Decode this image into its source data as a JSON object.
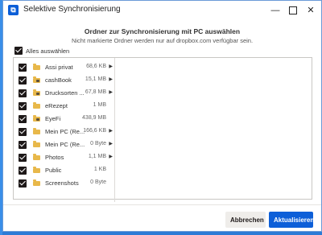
{
  "window": {
    "title": "Selektive Synchronisierung",
    "app_icon": "dropbox-app-icon"
  },
  "dialog": {
    "heading": "Ordner zur Synchronisierung mit PC auswählen",
    "subheading": "Nicht markierte Ordner werden nur auf dropbox.com verfügbar sein."
  },
  "select_all": {
    "label": "Alles auswählen",
    "checked": true
  },
  "folders": [
    {
      "name": "Assi privat",
      "size": "68,6 KB",
      "has_children": true,
      "shared": false,
      "checked": true
    },
    {
      "name": "cashBook",
      "size": "15,1 MB",
      "has_children": true,
      "shared": true,
      "checked": true
    },
    {
      "name": "Drucksorten ...",
      "size": "67,8 MB",
      "has_children": true,
      "shared": true,
      "checked": true
    },
    {
      "name": "eRezept",
      "size": "1 MB",
      "has_children": false,
      "shared": false,
      "checked": true
    },
    {
      "name": "EyeFi",
      "size": "438,9 MB",
      "has_children": false,
      "shared": true,
      "checked": true
    },
    {
      "name": "Mein PC (Re...",
      "size": "166,6 KB",
      "has_children": true,
      "shared": false,
      "checked": true
    },
    {
      "name": "Mein PC (Re...",
      "size": "0 Byte",
      "has_children": true,
      "shared": false,
      "checked": true
    },
    {
      "name": "Photos",
      "size": "1,1 MB",
      "has_children": true,
      "shared": false,
      "checked": true
    },
    {
      "name": "Public",
      "size": "1 KB",
      "has_children": false,
      "shared": false,
      "checked": true
    },
    {
      "name": "Screenshots",
      "size": "0 Byte",
      "has_children": false,
      "shared": false,
      "checked": true
    }
  ],
  "buttons": {
    "cancel": "Abbrechen",
    "update": "Aktualisieren"
  },
  "colors": {
    "accent": "#0d5fd8",
    "folder": "#e8b84a",
    "checkbox": "#1e1919"
  }
}
